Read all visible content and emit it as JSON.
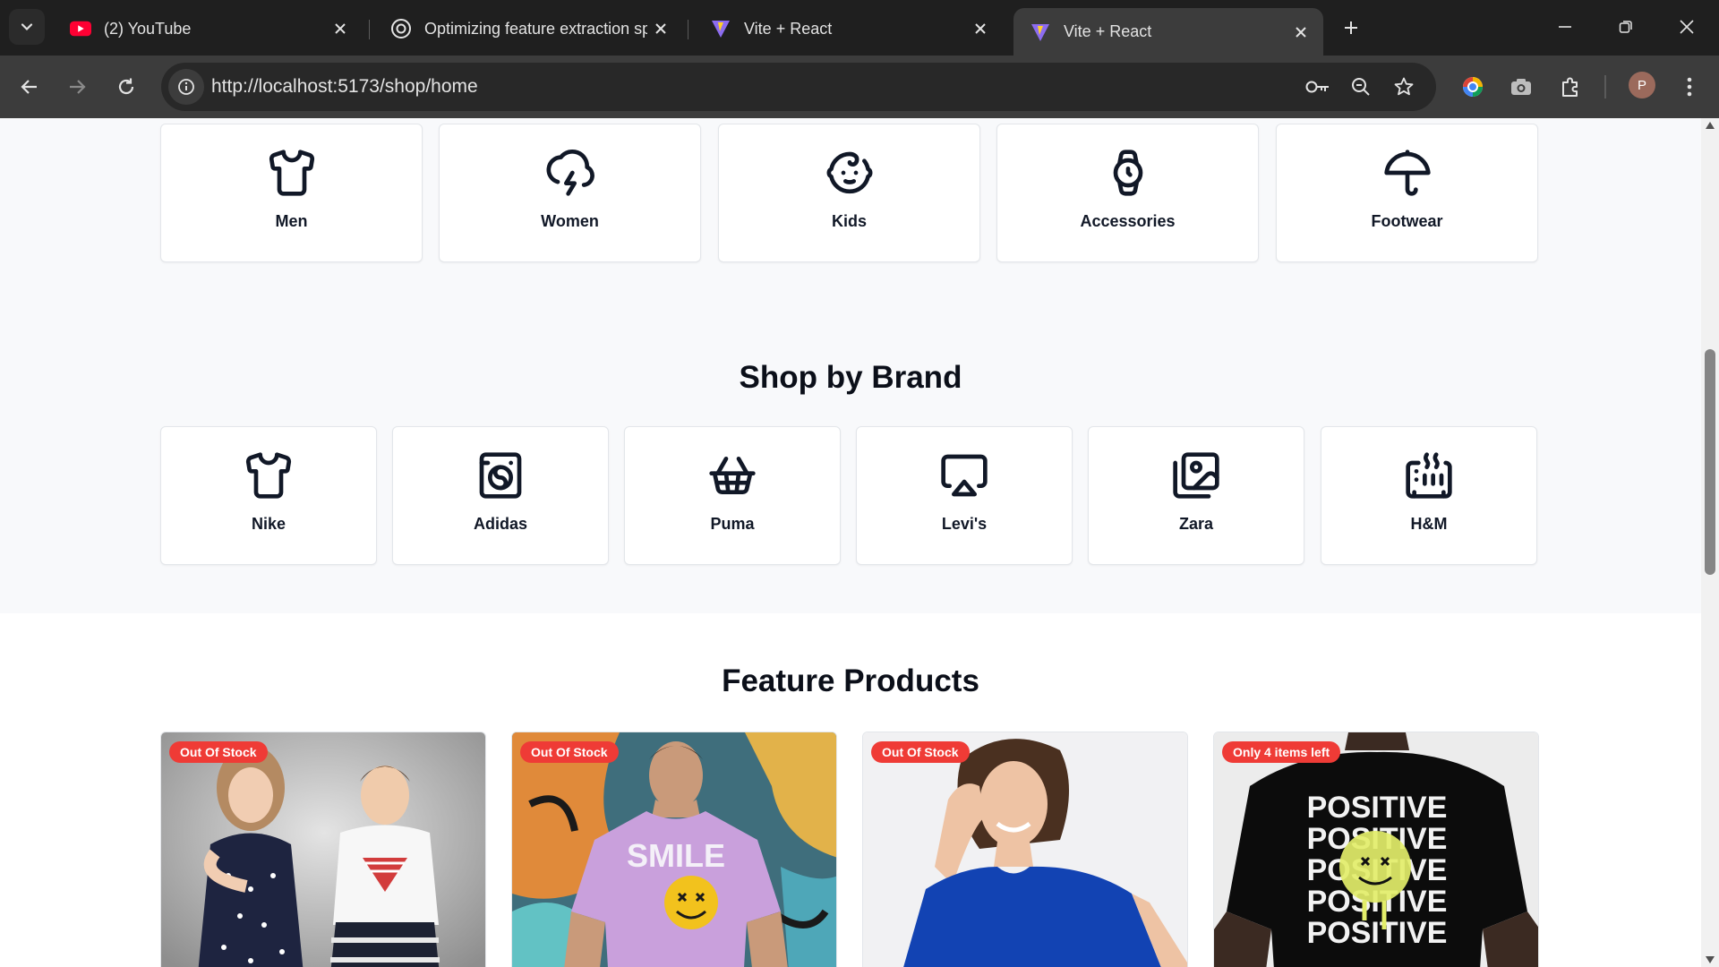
{
  "browser": {
    "tabs": [
      {
        "title": "(2) YouTube",
        "icon": "youtube-icon"
      },
      {
        "title": "Optimizing feature extraction sp",
        "icon": "openai-icon"
      },
      {
        "title": "Vite + React",
        "icon": "vite-icon"
      },
      {
        "title": "Vite + React",
        "icon": "vite-icon",
        "active": true
      }
    ],
    "url": "http://localhost:5173/shop/home",
    "profile_initial": "P"
  },
  "categories": [
    {
      "label": "Men",
      "icon": "shirt-icon"
    },
    {
      "label": "Women",
      "icon": "cloud-lightning-icon"
    },
    {
      "label": "Kids",
      "icon": "baby-icon"
    },
    {
      "label": "Accessories",
      "icon": "watch-icon"
    },
    {
      "label": "Footwear",
      "icon": "umbrella-icon"
    }
  ],
  "brand_section": {
    "title": "Shop by Brand",
    "brands": [
      {
        "label": "Nike",
        "icon": "shirt-icon"
      },
      {
        "label": "Adidas",
        "icon": "washing-machine-icon"
      },
      {
        "label": "Puma",
        "icon": "shopping-basket-icon"
      },
      {
        "label": "Levi's",
        "icon": "airplay-icon"
      },
      {
        "label": "Zara",
        "icon": "images-icon"
      },
      {
        "label": "H&M",
        "icon": "heater-icon"
      }
    ]
  },
  "featured_section": {
    "title": "Feature Products",
    "products": [
      {
        "badge": "Out Of Stock",
        "image": "kids-outfit-photo"
      },
      {
        "badge": "Out Of Stock",
        "image": "smile-tshirt-photo"
      },
      {
        "badge": "Out Of Stock",
        "image": "blue-tshirt-woman-photo"
      },
      {
        "badge": "Only 4 items left",
        "image": "positive-black-tshirt-photo"
      }
    ]
  },
  "colors": {
    "badge": "#ef3b36",
    "page_gray": "#f8f9fb",
    "chrome_dark": "#1f1f1f",
    "chrome_toolbar": "#3c3c3c"
  }
}
